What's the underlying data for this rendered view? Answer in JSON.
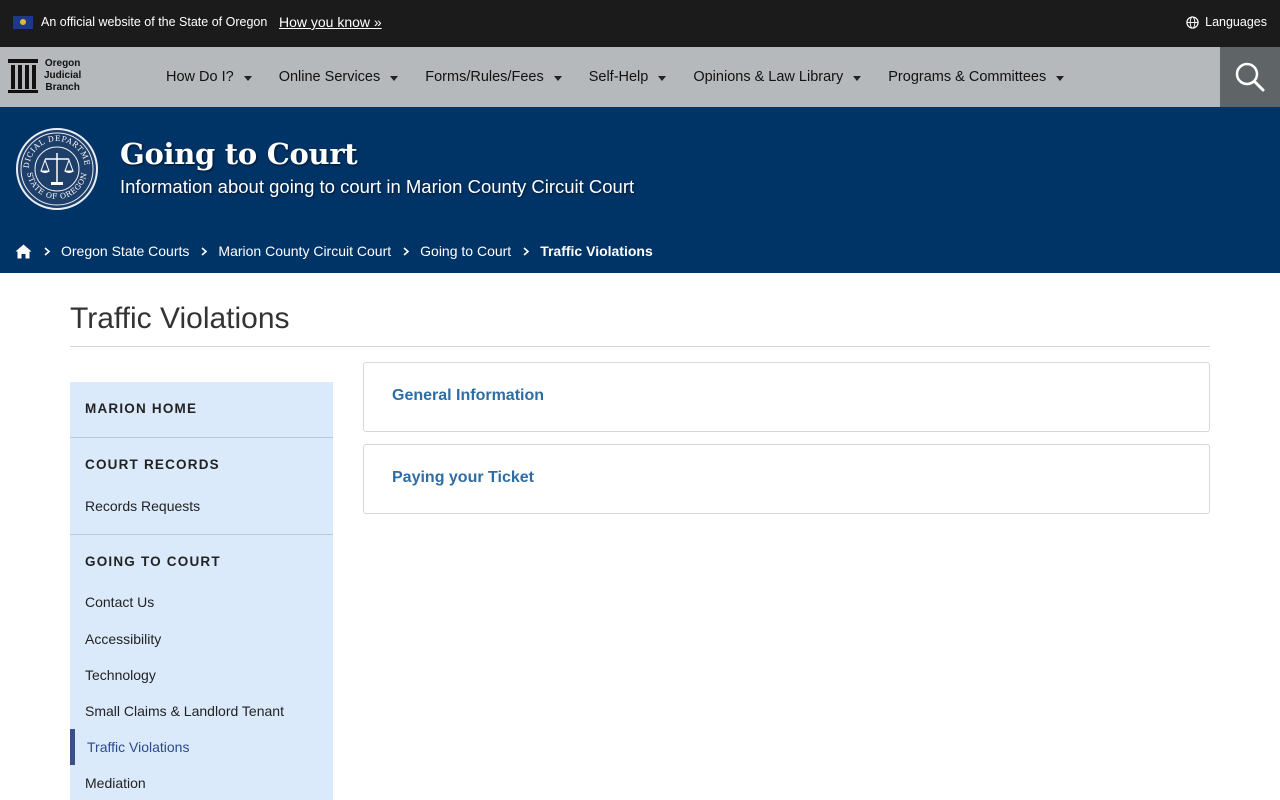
{
  "official_bar": {
    "text": "An official website of the State of Oregon",
    "how_link": "How you know »",
    "languages": "Languages"
  },
  "logo": {
    "line1": "Oregon",
    "line2": "Judicial",
    "line3": "Branch"
  },
  "nav": {
    "items": [
      {
        "label": "How Do I?"
      },
      {
        "label": "Online Services"
      },
      {
        "label": "Forms/Rules/Fees"
      },
      {
        "label": "Self-Help"
      },
      {
        "label": "Opinions & Law Library"
      },
      {
        "label": "Programs & Committees"
      }
    ]
  },
  "hero": {
    "title": "Going to Court",
    "subtitle": "Information about going to court in Marion County Circuit Court",
    "seal_top": "JUDICIAL DEPARTMENT",
    "seal_bottom": "STATE OF OREGON"
  },
  "breadcrumb": {
    "items": [
      {
        "label": "Oregon State Courts"
      },
      {
        "label": "Marion County Circuit Court"
      },
      {
        "label": "Going to Court"
      },
      {
        "label": "Traffic Violations"
      }
    ]
  },
  "page": {
    "title": "Traffic Violations"
  },
  "sidebar": {
    "home": "MARION HOME",
    "court_records": "COURT RECORDS",
    "records_links": [
      "Records Requests"
    ],
    "going_to_court": "GOING TO COURT",
    "court_links": [
      "Contact Us",
      "Accessibility",
      "Technology",
      "Small Claims & Landlord Tenant",
      "Traffic Violations",
      "Mediation"
    ]
  },
  "panels": [
    {
      "title": "General Information"
    },
    {
      "title": "Paying your Ticket"
    }
  ],
  "colors": {
    "official_bar": "#1b1b1b",
    "nav": "#b5b9bc",
    "hero": "#003366",
    "sidebar": "#dbeafb",
    "link": "#2e6da4",
    "active_marker": "#3b4f8a"
  }
}
